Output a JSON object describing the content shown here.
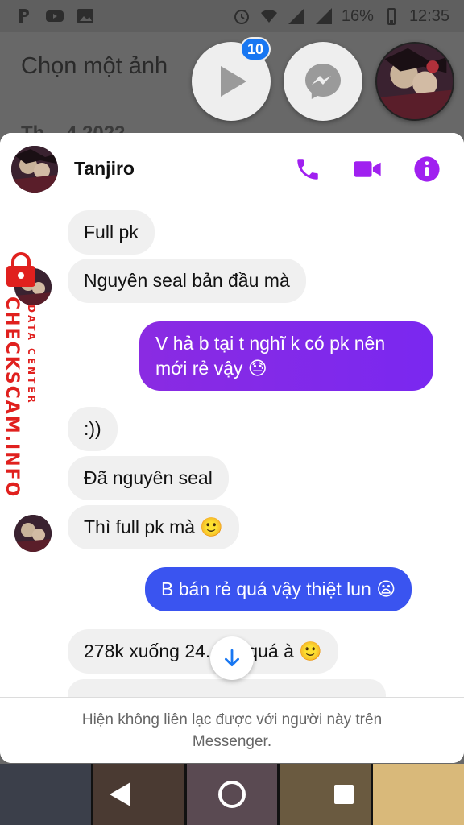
{
  "status_bar": {
    "battery": "16%",
    "time": "12:35",
    "icons": [
      "parking-icon",
      "youtube-icon",
      "gallery-icon",
      "alarm-icon",
      "wifi-icon",
      "signal-icon",
      "signal-icon",
      "battery-icon"
    ]
  },
  "background": {
    "title": "Chọn một ảnh",
    "partial_text": "Th... 4 2022"
  },
  "chat_heads": {
    "play_badge": "10"
  },
  "chat": {
    "contact_name": "Tanjiro",
    "messages": [
      {
        "dir": "in",
        "text": "Full pk"
      },
      {
        "dir": "in",
        "text": "Nguyên seal bản đầu mà"
      },
      {
        "dir": "out",
        "text": "V hả b tại t nghĩ k có pk nên mới rẻ vậy 😓"
      },
      {
        "dir": "in",
        "text": ":))"
      },
      {
        "dir": "in",
        "text": "Đã nguyên seal"
      },
      {
        "dir": "in",
        "text": "Thì full pk mà 🙂"
      },
      {
        "dir": "out",
        "text": "B bán rẻ quá vậy thiệt lun 😦"
      },
      {
        "dir": "in",
        "text": "278k xuống 24... rẻ quá à 🙂"
      }
    ],
    "footer_note": "Hiện không liên lạc được với người này trên Messenger."
  },
  "watermark": {
    "main": "CHECKSCAM.INFO",
    "sub": "DATA CENTER"
  }
}
